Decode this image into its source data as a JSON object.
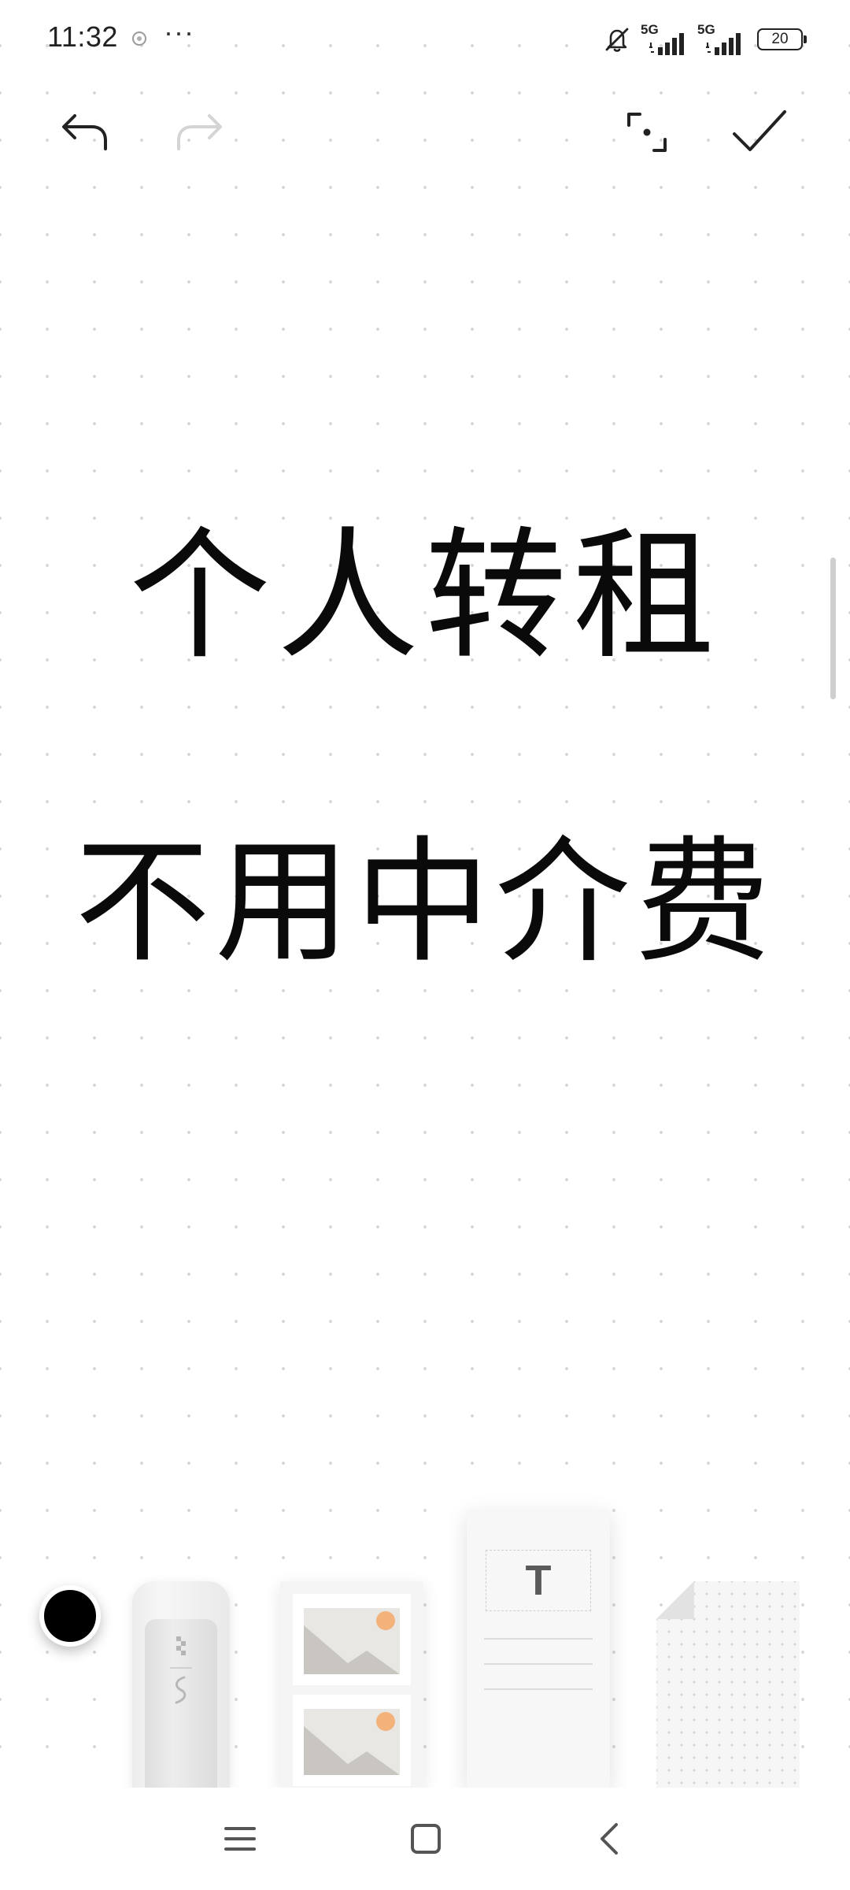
{
  "status_bar": {
    "time": "11:32",
    "more": "···",
    "network_1": "5G",
    "network_2": "5G",
    "battery": "20"
  },
  "note": {
    "line_1": "个人转租",
    "line_2": "不用中介费"
  },
  "toolbar": {
    "icons": [
      "undo-icon",
      "redo-icon",
      "fullscreen-icon",
      "checkmark-icon"
    ]
  },
  "tray": {
    "text_template_letter": "T",
    "selected_color": "#000000"
  },
  "colors": {
    "ink": "#0a0a0a",
    "accent_orange": "#f2b27a",
    "disabled": "#cfcfcf"
  }
}
